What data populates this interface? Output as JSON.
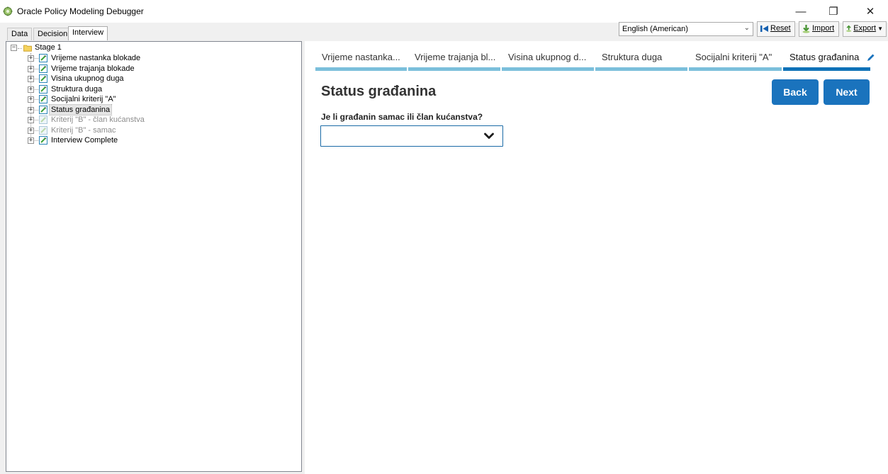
{
  "window": {
    "title": "Oracle Policy Modeling Debugger",
    "minimize_glyph": "—",
    "maximize_glyph": "❐",
    "close_glyph": "✕"
  },
  "tabs": [
    {
      "label": "Data"
    },
    {
      "label": "Decision"
    },
    {
      "label": "Interview",
      "active": true
    }
  ],
  "toolbar": {
    "language": "English (American)",
    "reset_label": "Reset",
    "import_label": "Import",
    "export_label": "Export"
  },
  "tree": {
    "root": {
      "label": "Stage 1"
    },
    "items": [
      {
        "label": "Vrijeme nastanka blokade",
        "state": "normal"
      },
      {
        "label": "Vrijeme trajanja blokade",
        "state": "normal"
      },
      {
        "label": "Visina ukupnog duga",
        "state": "normal"
      },
      {
        "label": "Struktura duga",
        "state": "normal"
      },
      {
        "label": "Socijalni kriterij \"A\"",
        "state": "normal"
      },
      {
        "label": "Status građanina",
        "state": "selected"
      },
      {
        "label": "Kriterij \"B\" - član kućanstva",
        "state": "disabled"
      },
      {
        "label": "Kriterij \"B\" - samac",
        "state": "disabled"
      },
      {
        "label": "Interview Complete",
        "state": "normal"
      }
    ]
  },
  "interview": {
    "stages": [
      {
        "label": "Vrijeme nastanka..."
      },
      {
        "label": "Vrijeme trajanja bl..."
      },
      {
        "label": "Visina ukupnog d..."
      },
      {
        "label": "Struktura duga"
      },
      {
        "label": "Socijalni kriterij \"A\""
      },
      {
        "label": "Status građanina",
        "current": true
      }
    ],
    "page_title": "Status građanina",
    "back_label": "Back",
    "next_label": "Next",
    "question": "Je li građanin samac ili član kućanstva?",
    "answer_value": ""
  },
  "colors": {
    "accent": "#1a73bd",
    "stage_bar": "#7bbfdb",
    "stage_bar_current": "#0f72b8"
  }
}
